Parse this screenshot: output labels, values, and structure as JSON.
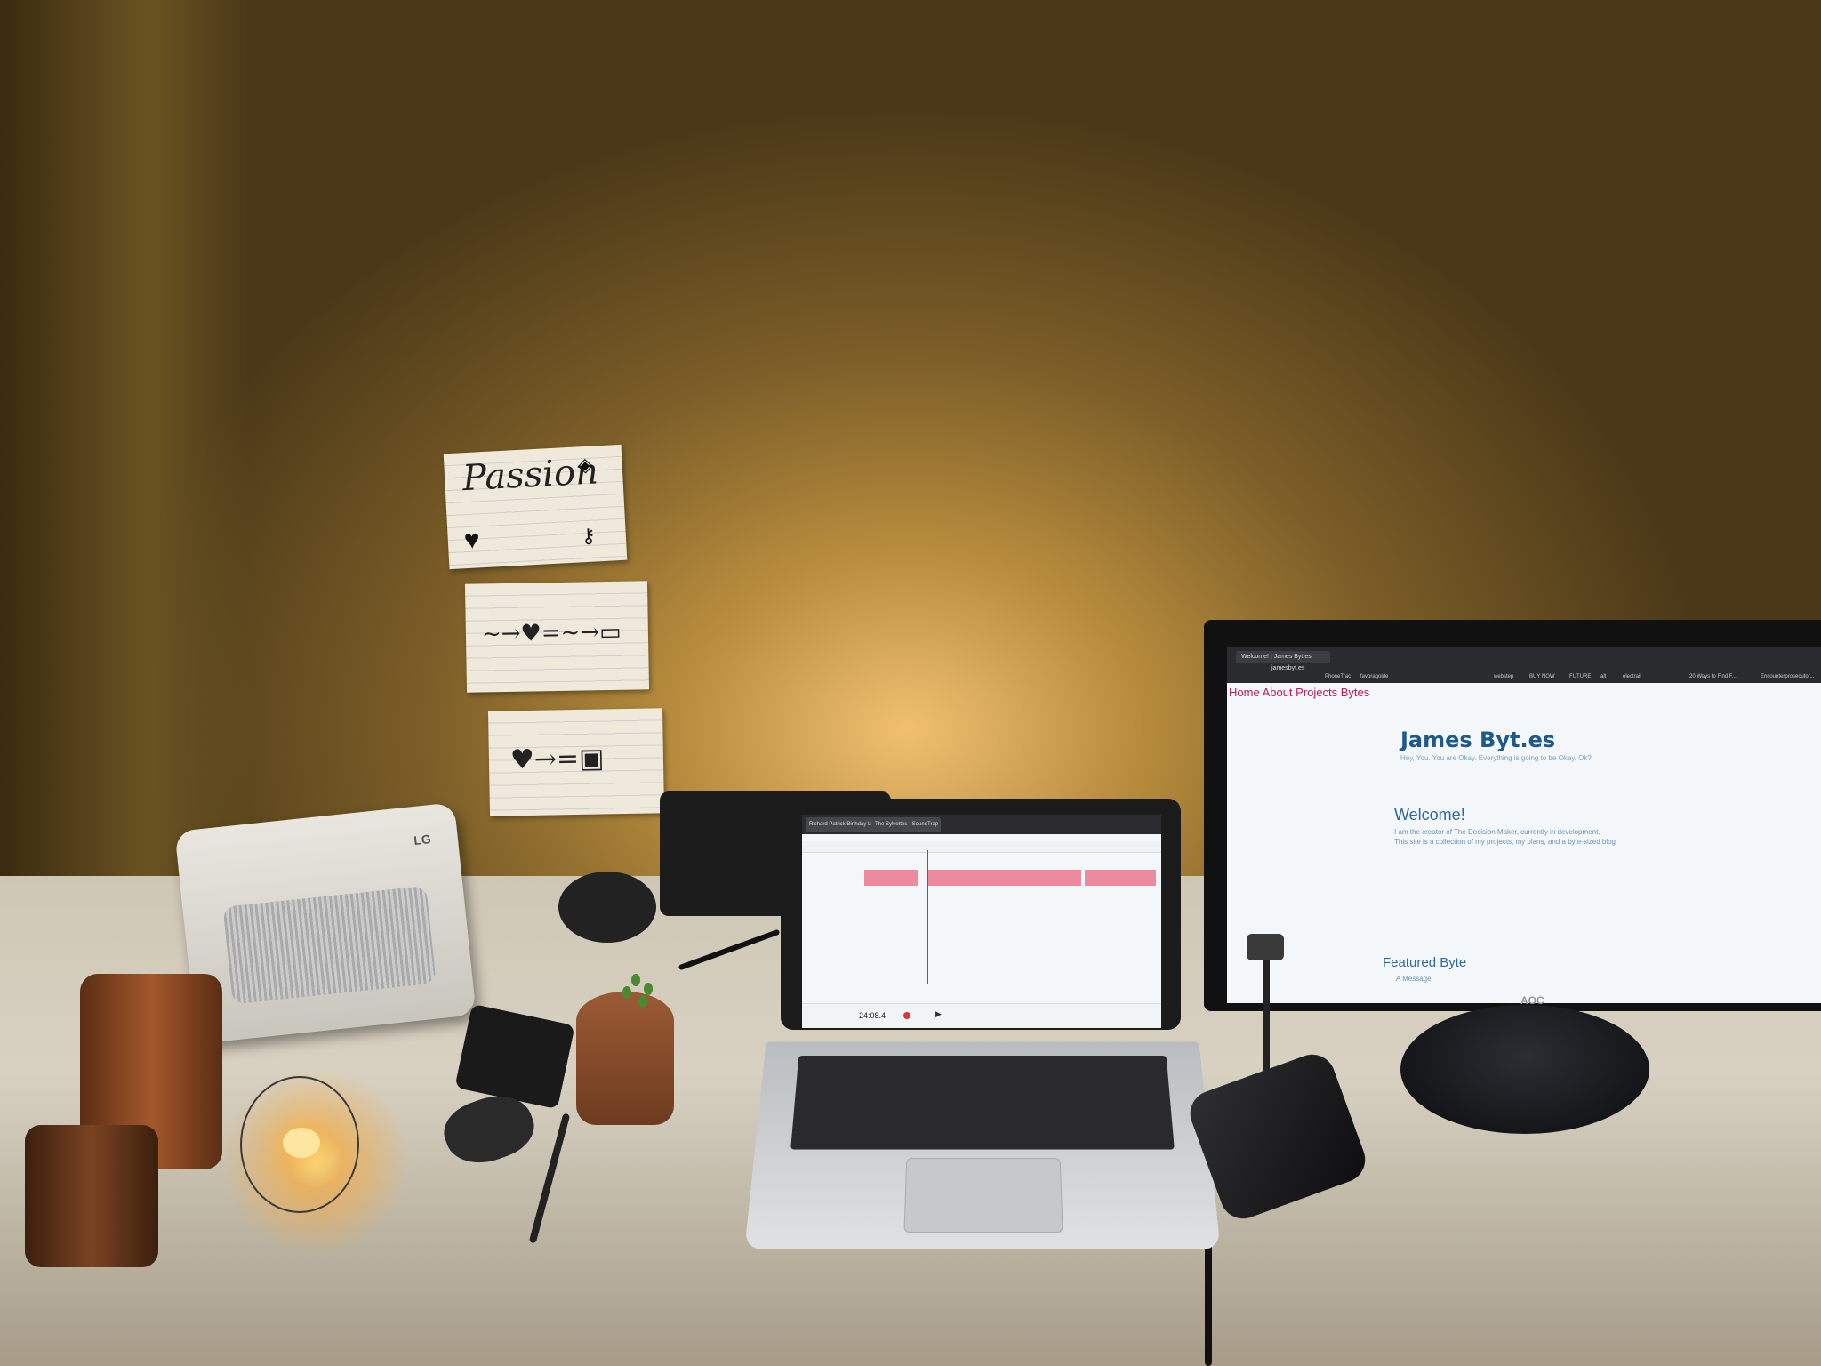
{
  "wall_notes": {
    "note1": {
      "title": "Passion"
    },
    "note2": {
      "symbols": "~→♥=~→▭"
    },
    "note3": {
      "symbols": "♥→=▣"
    }
  },
  "speaker": {
    "brand": "LG"
  },
  "laptop": {
    "tabs": [
      "Richard Patrick Birthday Lifest...",
      "The Sylvettes - SoundTrap"
    ],
    "time_readout": "24:08.4"
  },
  "monitor": {
    "tab_title": "Welcome! | James Byt.es",
    "url": "jamesbyt.es",
    "bookmarks": [
      "PhoneTrac",
      "favoragoide",
      "webstep",
      "BUY NOW",
      "FUTURE",
      "alt",
      "electrail",
      "20 Ways to Find F...",
      "Encounterprosecutor..."
    ],
    "nav": "Home About Projects Bytes",
    "site_title": "James Byt.es",
    "site_subtitle": "Hey, You. You are Okay. Everything is going to be Okay. Ok?",
    "welcome_heading": "Welcome!",
    "welcome_line1": "I am the creator of The Decision Maker, currently in development.",
    "welcome_line2": "This site is a collection of my projects, my plans, and a byte-sized blog",
    "featured_heading": "Featured Byte",
    "featured_item": "A Message",
    "brand": "AOC"
  },
  "colors": {
    "accent_nav": "#c2185b",
    "site_blue": "#1d5a8a",
    "track_pink": "#ee8aa0"
  }
}
